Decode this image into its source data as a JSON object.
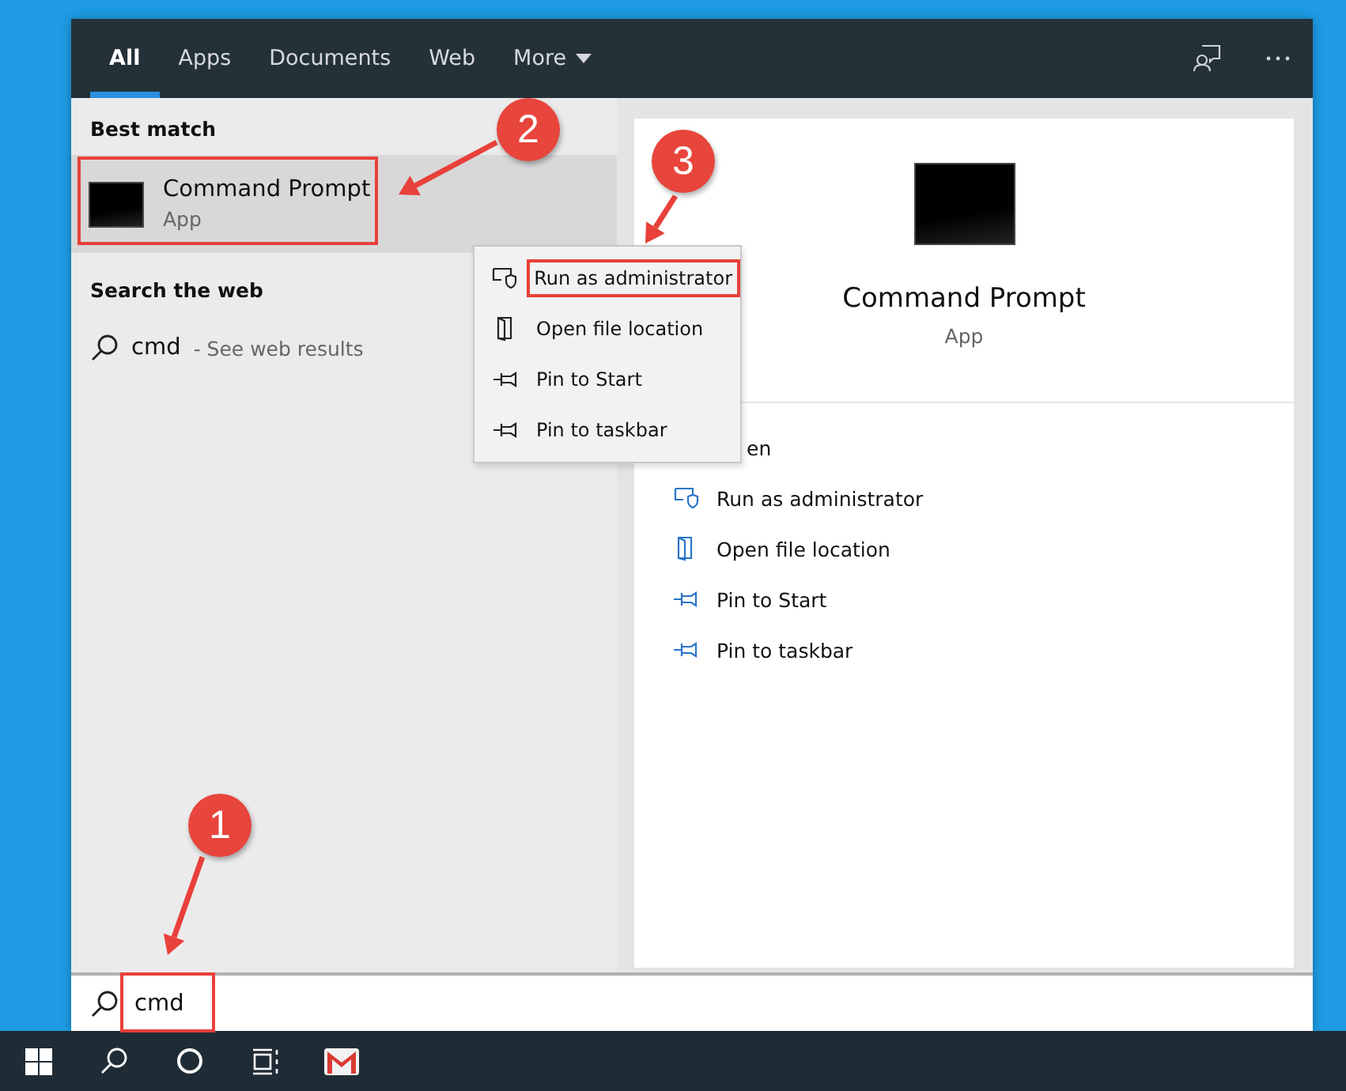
{
  "tabs": [
    {
      "label": "All",
      "selected": true
    },
    {
      "label": "Apps",
      "selected": false
    },
    {
      "label": "Documents",
      "selected": false
    },
    {
      "label": "Web",
      "selected": false
    },
    {
      "label": "More",
      "selected": false,
      "dropdown": true
    }
  ],
  "best_match": {
    "heading": "Best match",
    "title": "Command Prompt",
    "subtitle": "App",
    "selected": true
  },
  "search_web": {
    "heading": "Search the web",
    "query": "cmd",
    "hint": "- See web results"
  },
  "context_menu": [
    {
      "kind": "admin",
      "label": "Run as administrator",
      "highlighted": true
    },
    {
      "kind": "folder",
      "label": "Open file location",
      "highlighted": false
    },
    {
      "kind": "pin",
      "label": "Pin to Start",
      "highlighted": false
    },
    {
      "kind": "pin",
      "label": "Pin to taskbar",
      "highlighted": false
    }
  ],
  "details": {
    "title": "Command Prompt",
    "subtitle": "App",
    "actions": [
      {
        "kind": "open",
        "label": "en"
      },
      {
        "kind": "admin",
        "label": "Run as administrator"
      },
      {
        "kind": "folder",
        "label": "Open file location"
      },
      {
        "kind": "pin",
        "label": "Pin to Start"
      },
      {
        "kind": "pin",
        "label": "Pin to taskbar"
      }
    ]
  },
  "search_box": {
    "value": "cmd"
  },
  "annotations": [
    {
      "number": "1"
    },
    {
      "number": "2"
    },
    {
      "number": "3"
    }
  ]
}
